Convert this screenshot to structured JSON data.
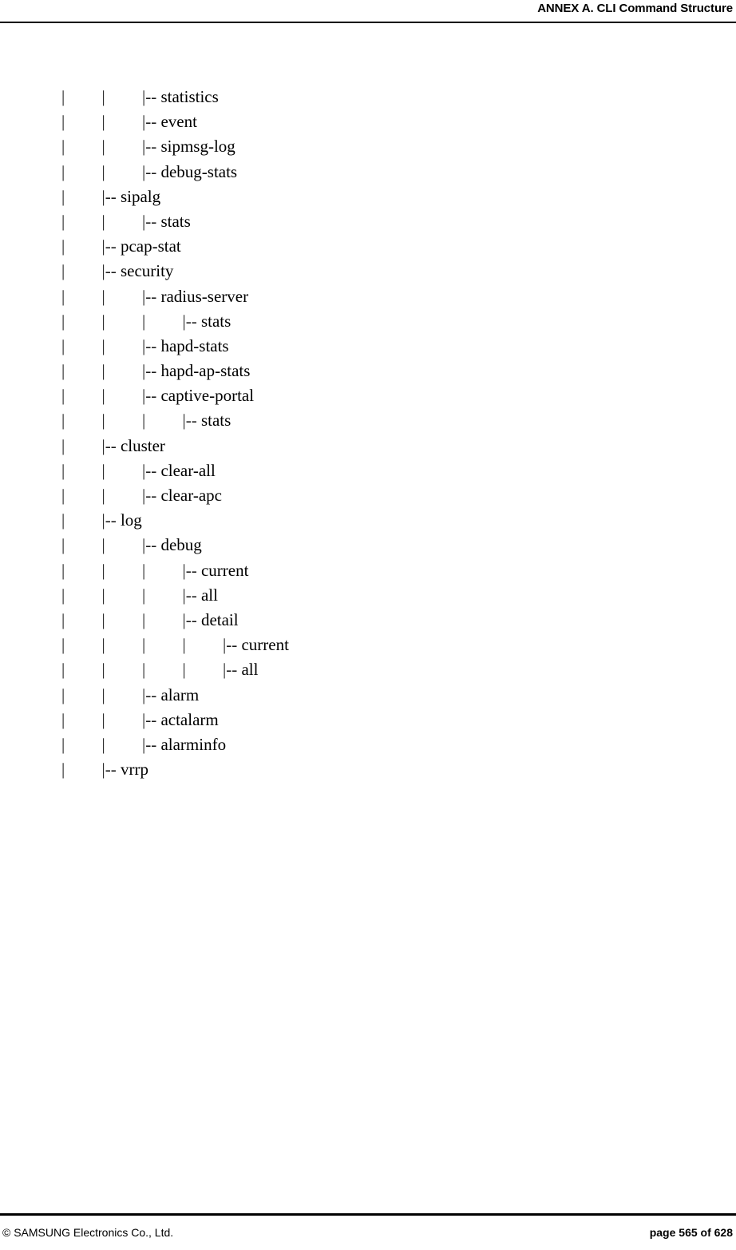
{
  "header": {
    "title": "ANNEX A. CLI Command Structure"
  },
  "footer": {
    "copyright": "© SAMSUNG Electronics Co., Ltd.",
    "page_label": "page 565 of 628"
  },
  "tree": {
    "pipe_glyph": "|",
    "branch_glyph": "|-- ",
    "lines": [
      {
        "depth": 3,
        "label": "statistics"
      },
      {
        "depth": 3,
        "label": "event"
      },
      {
        "depth": 3,
        "label": "sipmsg-log"
      },
      {
        "depth": 3,
        "label": "debug-stats"
      },
      {
        "depth": 2,
        "label": "sipalg"
      },
      {
        "depth": 3,
        "label": "stats"
      },
      {
        "depth": 2,
        "label": "pcap-stat"
      },
      {
        "depth": 2,
        "label": "security"
      },
      {
        "depth": 3,
        "label": "radius-server"
      },
      {
        "depth": 4,
        "label": "stats"
      },
      {
        "depth": 3,
        "label": "hapd-stats"
      },
      {
        "depth": 3,
        "label": "hapd-ap-stats"
      },
      {
        "depth": 3,
        "label": "captive-portal"
      },
      {
        "depth": 4,
        "label": "stats"
      },
      {
        "depth": 2,
        "label": "cluster"
      },
      {
        "depth": 3,
        "label": "clear-all"
      },
      {
        "depth": 3,
        "label": "clear-apc"
      },
      {
        "depth": 2,
        "label": "log"
      },
      {
        "depth": 3,
        "label": "debug"
      },
      {
        "depth": 4,
        "label": "current"
      },
      {
        "depth": 4,
        "label": "all"
      },
      {
        "depth": 4,
        "label": "detail"
      },
      {
        "depth": 5,
        "label": "current"
      },
      {
        "depth": 5,
        "label": "all"
      },
      {
        "depth": 3,
        "label": "alarm"
      },
      {
        "depth": 3,
        "label": "actalarm"
      },
      {
        "depth": 3,
        "label": "alarminfo"
      },
      {
        "depth": 2,
        "label": "vrrp"
      }
    ]
  }
}
